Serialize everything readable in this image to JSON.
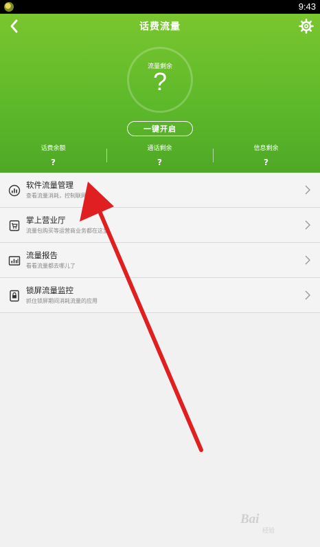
{
  "status_bar": {
    "time": "9:43"
  },
  "header": {
    "title": "话费流量",
    "ring_label": "流量剩余",
    "ring_value": "?",
    "one_key_button": "一键开启"
  },
  "stats": [
    {
      "label": "话费余额",
      "value": "?"
    },
    {
      "label": "通话剩余",
      "value": "?"
    },
    {
      "label": "信息剩余",
      "value": "?"
    }
  ],
  "menu": [
    {
      "title": "软件流量管理",
      "desc": "查看流量消耗，控制联网权限",
      "icon": "bar-chart-icon"
    },
    {
      "title": "掌上营业厅",
      "desc": "流量包购买等运营商业务都在这里",
      "icon": "shop-icon"
    },
    {
      "title": "流量报告",
      "desc": "看看流量都去哪儿了",
      "icon": "report-chart-icon"
    },
    {
      "title": "锁屏流量监控",
      "desc": "抓住锁屏期间消耗流量的应用",
      "icon": "lock-screen-monitor-icon"
    }
  ],
  "watermark": {
    "brand": "Bai",
    "sub": "经验"
  },
  "colors": {
    "header_green": "#5cb82a",
    "arrow_red": "#e02020"
  }
}
